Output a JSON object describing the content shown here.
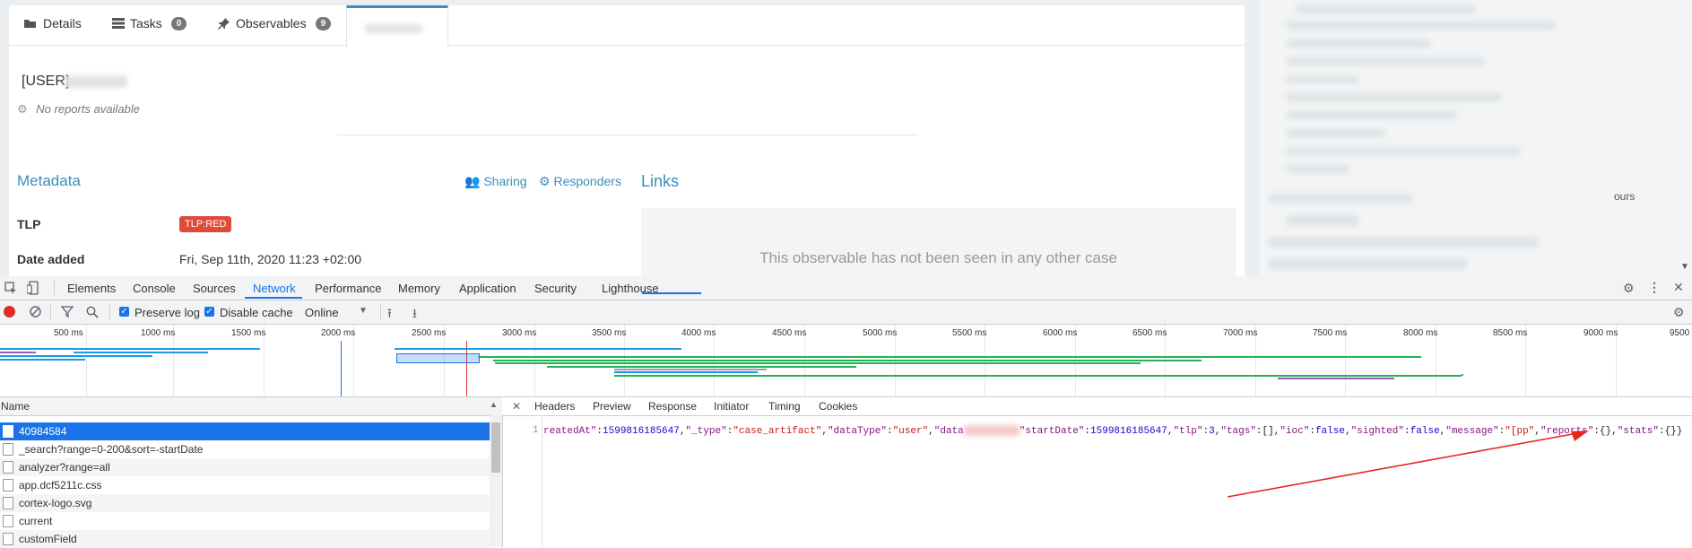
{
  "app": {
    "tabs": [
      {
        "label": "Details",
        "icon": "folder-open-icon"
      },
      {
        "label": "Tasks",
        "icon": "tasks-icon",
        "count": "0"
      },
      {
        "label": "Observables",
        "icon": "pin-icon",
        "count": "9"
      }
    ],
    "observable_title": "[USER]",
    "no_reports": "No reports available",
    "metadata_heading": "Metadata",
    "sharing_label": "Sharing",
    "responders_label": "Responders",
    "links_heading": "Links",
    "tlp_label": "TLP",
    "tlp_value": "TLP:RED",
    "date_added_label": "Date added",
    "date_added_value": "Fri, Sep 11th, 2020 11:23 +02:00",
    "links_message": "This observable has not been seen in any other case",
    "right_panel_fragment": "ours"
  },
  "devtools": {
    "tabs": [
      "Elements",
      "Console",
      "Sources",
      "Network",
      "Performance",
      "Memory",
      "Application",
      "Security",
      "Lighthouse"
    ],
    "active_tab": "Network",
    "preserve_log": "Preserve log",
    "disable_cache": "Disable cache",
    "throttle": "Online",
    "timeline_ticks": [
      "500 ms",
      "1000 ms",
      "1500 ms",
      "2000 ms",
      "2500 ms",
      "3000 ms",
      "3500 ms",
      "4000 ms",
      "4500 ms",
      "5000 ms",
      "5500 ms",
      "6000 ms",
      "6500 ms",
      "7000 ms",
      "7500 ms",
      "8000 ms",
      "8500 ms",
      "9000 ms",
      "9500"
    ],
    "name_header": "Name",
    "requests": [
      "40984584",
      "_search?range=0-200&sort=-startDate",
      "analyzer?range=all",
      "app.dcf5211c.css",
      "cortex-logo.svg",
      "current",
      "customField"
    ],
    "detail_tabs": [
      "Headers",
      "Preview",
      "Response",
      "Initiator",
      "Timing",
      "Cookies"
    ],
    "active_detail_tab": "Response",
    "line_number": "1",
    "colors": {
      "accent": "#1a73e8",
      "red": "#d93025"
    }
  }
}
